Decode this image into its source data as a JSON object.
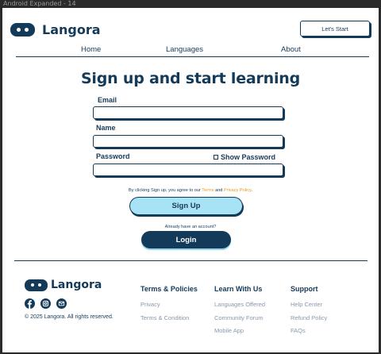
{
  "frame_title": "Android Expanded - 14",
  "brand": {
    "name": "Langora",
    "icon": "robot-face-logo-icon",
    "color": "#143a5a",
    "accent": "#a8e2f5",
    "link_color": "#e89a1a"
  },
  "header": {
    "cta_label": "Let's Start"
  },
  "nav": {
    "items": [
      {
        "label": "Home"
      },
      {
        "label": "Languages"
      },
      {
        "label": "About"
      }
    ]
  },
  "form": {
    "title": "Sign up and start learning",
    "email_label": "Email",
    "email_value": "",
    "name_label": "Name",
    "name_value": "",
    "password_label": "Password",
    "password_value": "",
    "show_password_label": "Show Password",
    "show_password_checked": false,
    "terms_prefix": "By clicking Sign up, you agree to our ",
    "terms_link": "Terms",
    "terms_mid": " and ",
    "privacy_link": "Privacy Policy",
    "terms_suffix": ".",
    "signup_label": "Sign Up",
    "already_text": "Already have an account?",
    "login_label": "Login"
  },
  "footer": {
    "brand_name": "Langora",
    "socials": [
      {
        "icon": "facebook-icon"
      },
      {
        "icon": "instagram-icon"
      },
      {
        "icon": "email-icon"
      }
    ],
    "copyright": "© 2025 Langora. All rights reserved.",
    "columns": [
      {
        "title": "Terms & Policies",
        "links": [
          "Privacy",
          "Terms & Condition"
        ]
      },
      {
        "title": "Learn With Us",
        "links": [
          "Languages Offered",
          "Community Forum",
          "Mobile App"
        ]
      },
      {
        "title": "Support",
        "links": [
          "Help Center",
          "Refund Policy",
          "FAQs"
        ]
      }
    ]
  }
}
